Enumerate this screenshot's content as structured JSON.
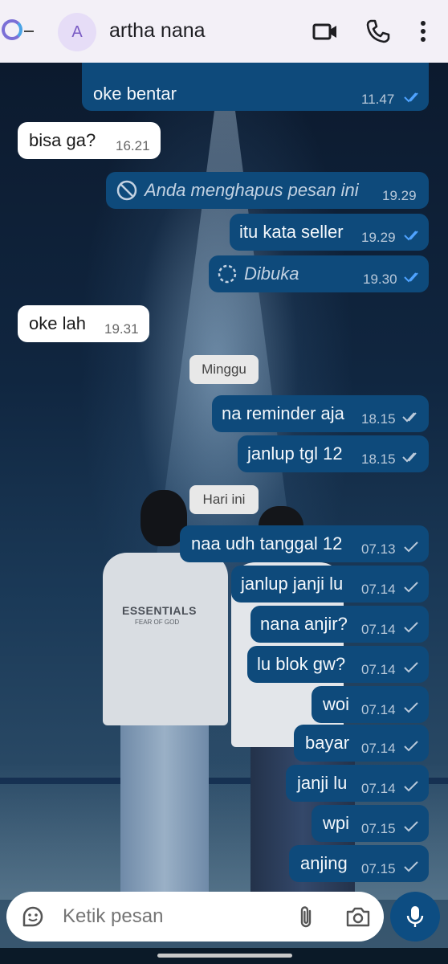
{
  "header": {
    "contact_name": "artha nana",
    "avatar_letter": "A"
  },
  "messages": [
    {
      "direction": "out",
      "text": "oke bentar",
      "time": "11.47",
      "status": "read"
    },
    {
      "direction": "in",
      "text": "bisa ga?",
      "time": "16.21"
    },
    {
      "direction": "out",
      "text": "Anda menghapus pesan ini",
      "time": "19.29",
      "type": "deleted"
    },
    {
      "direction": "out",
      "text": "itu kata seller",
      "time": "19.29",
      "status": "read"
    },
    {
      "direction": "out",
      "text": "Dibuka",
      "time": "19.30",
      "status": "read",
      "type": "view-once-opened"
    },
    {
      "direction": "in",
      "text": "oke lah",
      "time": "19.31"
    },
    {
      "direction": "out",
      "text": "na reminder aja",
      "time": "18.15",
      "status": "delivered"
    },
    {
      "direction": "out",
      "text": "janlup tgl 12",
      "time": "18.15",
      "status": "delivered"
    },
    {
      "direction": "out",
      "text": "naa udh tanggal 12",
      "time": "07.13",
      "status": "sent"
    },
    {
      "direction": "out",
      "text": "janlup janji lu",
      "time": "07.14",
      "status": "sent"
    },
    {
      "direction": "out",
      "text": "nana anjir?",
      "time": "07.14",
      "status": "sent"
    },
    {
      "direction": "out",
      "text": "lu blok gw?",
      "time": "07.14",
      "status": "sent"
    },
    {
      "direction": "out",
      "text": "woi",
      "time": "07.14",
      "status": "sent"
    },
    {
      "direction": "out",
      "text": "bayar",
      "time": "07.14",
      "status": "sent"
    },
    {
      "direction": "out",
      "text": "janji lu",
      "time": "07.14",
      "status": "sent"
    },
    {
      "direction": "out",
      "text": "wpi",
      "time": "07.15",
      "status": "sent"
    },
    {
      "direction": "out",
      "text": "anjing",
      "time": "07.15",
      "status": "sent"
    }
  ],
  "date_separators": [
    "Minggu",
    "Hari ini"
  ],
  "wallpaper": {
    "shirt_text": "ESSENTIALS",
    "shirt_subtext": "FEAR OF GOD"
  },
  "composer": {
    "placeholder": "Ketik pesan"
  },
  "colors": {
    "outgoing_bubble": "#0e4a7b",
    "incoming_bubble": "#ffffff",
    "read_tick": "#4fa3ff",
    "mic_button": "#0d4d82"
  },
  "icons": [
    "video-call-icon",
    "voice-call-icon",
    "more-options-icon",
    "sticker-icon",
    "attach-icon",
    "camera-icon",
    "mic-icon",
    "blocked-icon",
    "view-once-icon"
  ]
}
